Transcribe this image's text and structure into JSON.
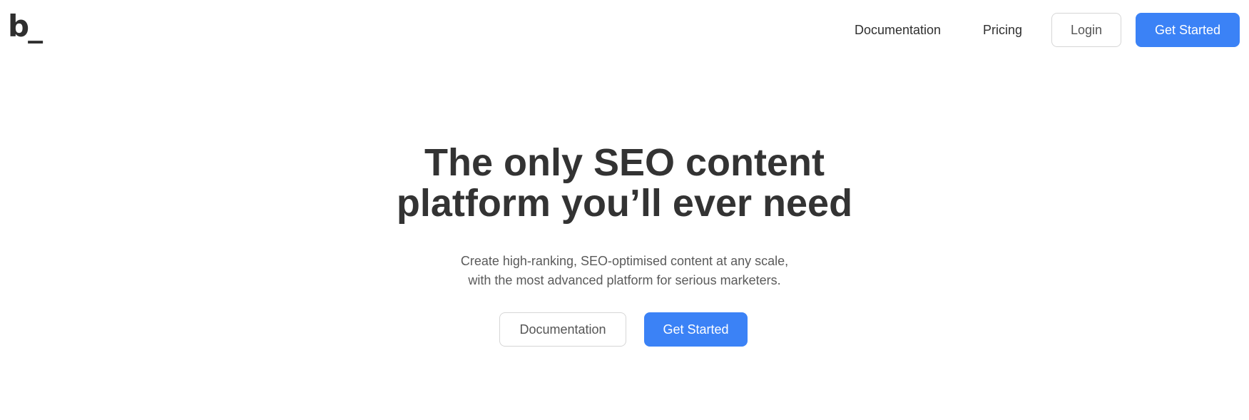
{
  "header": {
    "logo_text": "b_",
    "nav": {
      "documentation_label": "Documentation",
      "pricing_label": "Pricing",
      "login_label": "Login",
      "get_started_label": "Get Started"
    }
  },
  "hero": {
    "title_line1": "The only SEO content",
    "title_line2": "platform you’ll ever need",
    "subtitle_line1": "Create high-ranking, SEO-optimised content at any scale,",
    "subtitle_line2": "with the most advanced platform for serious marketers.",
    "documentation_button_label": "Documentation",
    "get_started_button_label": "Get Started"
  },
  "colors": {
    "primary": "#3b82f6",
    "text": "#333333",
    "muted_text": "#5a5a5a",
    "border": "#d6d6d6",
    "background": "#ffffff"
  }
}
